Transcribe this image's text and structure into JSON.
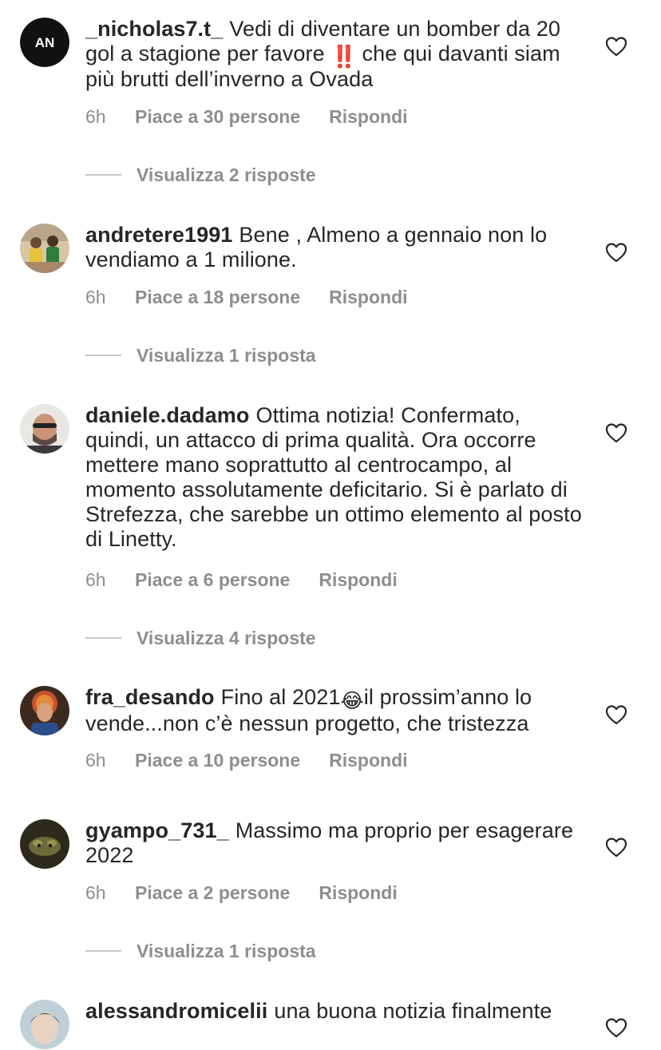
{
  "comments": [
    {
      "username": "_nicholas7.t_",
      "text_parts": [
        "Vedi di diventare un bomber da 20 gol a stagione per favore ",
        "‼️",
        " che qui davanti siam più brutti dell’inverno a Ovada"
      ],
      "avatar_initials": "AN",
      "time": "6h",
      "likes": "Piace a 30 persone",
      "reply_label": "Rispondi",
      "view_replies": "Visualizza 2 risposte"
    },
    {
      "username": "andretere1991",
      "text": "Bene , Almeno a gennaio non lo vendiamo a 1 milione.",
      "time": "6h",
      "likes": "Piace a 18 persone",
      "reply_label": "Rispondi",
      "view_replies": "Visualizza 1 risposta"
    },
    {
      "username": "daniele.dadamo",
      "text": "Ottima notizia! Confermato, quindi, un attacco di prima qualità. Ora occorre mettere mano soprattutto al centrocampo, al momento assolutamente deficitario. Si è parlato di Strefezza, che sarebbe un ottimo elemento al posto di Linetty.",
      "time": "6h",
      "likes": "Piace a 6 persone",
      "reply_label": "Rispondi",
      "view_replies": "Visualizza 4 risposte"
    },
    {
      "username": "fra_desando",
      "text_parts": [
        "Fino al 2021",
        "😂",
        "il prossim’anno lo vende...non c’è nessun progetto, che tristezza"
      ],
      "time": "6h",
      "likes": "Piace a 10 persone",
      "reply_label": "Rispondi"
    },
    {
      "username": "gyampo_731_",
      "text": "Massimo ma proprio per esagerare 2022",
      "time": "6h",
      "likes": "Piace a 2 persone",
      "reply_label": "Rispondi",
      "view_replies": "Visualizza 1 risposta"
    },
    {
      "username": "alessandromicelii",
      "text": "una buona notizia finalmente"
    }
  ],
  "icons": {
    "like": "heart-outline-icon"
  },
  "colors": {
    "text": "#262626",
    "secondary": "#8e8e8e",
    "divider": "#c7c7c7",
    "emoji_red": "#e0302a"
  }
}
